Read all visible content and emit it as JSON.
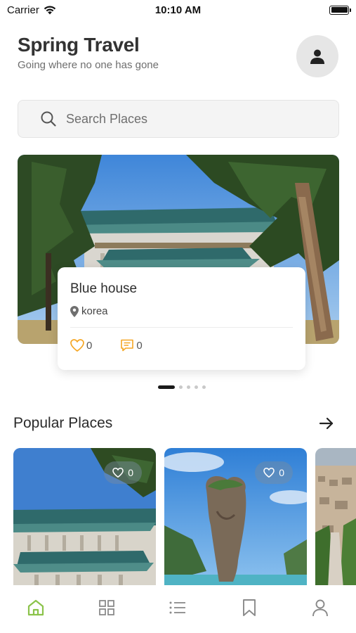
{
  "status_bar": {
    "carrier": "Carrier",
    "time": "10:10 AM"
  },
  "header": {
    "title": "Spring Travel",
    "subtitle": "Going where no one has gone"
  },
  "search": {
    "placeholder": "Search Places"
  },
  "featured": {
    "title": "Blue house",
    "location": "korea",
    "likes": "0",
    "comments": "0",
    "pager": {
      "count": 5,
      "active_index": 0
    }
  },
  "popular": {
    "title": "Popular Places",
    "items": [
      {
        "likes": "0"
      },
      {
        "likes": "0"
      }
    ]
  },
  "tabbar": {
    "items": [
      "home-icon",
      "grid-icon",
      "list-icon",
      "bookmark-icon",
      "profile-icon"
    ],
    "active": "home-icon",
    "accent": "#8bc34a",
    "inactive": "#8a8a8a"
  },
  "colors": {
    "heart": "#f5a623",
    "comment": "#f5a623"
  }
}
